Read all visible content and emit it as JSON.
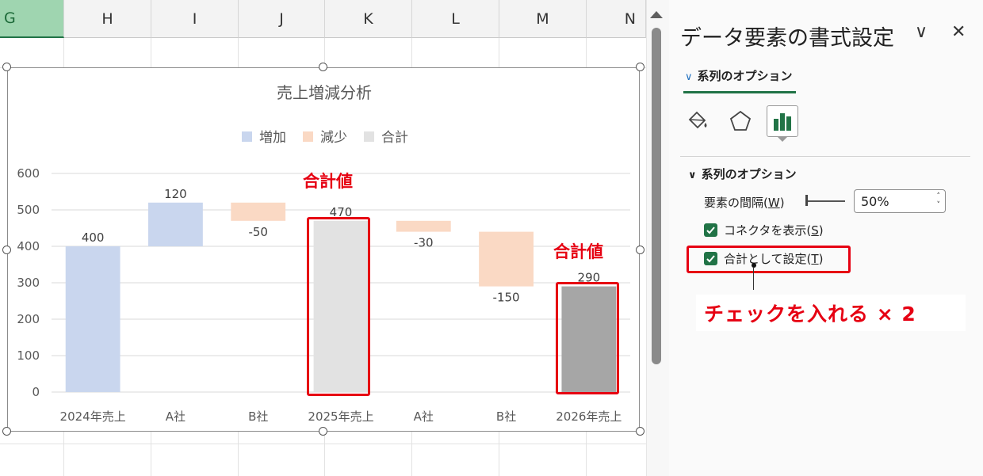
{
  "columns": [
    "G",
    "H",
    "I",
    "J",
    "K",
    "L",
    "M",
    "N"
  ],
  "panel": {
    "title": "データ要素の書式設定",
    "collapse_glyph": "∨",
    "close_glyph": "✕",
    "tab_label": "系列のオプション",
    "section_label": "系列のオプション",
    "gap_label_prefix": "要素の間隔(",
    "gap_label_key": "W",
    "gap_label_suffix": ")",
    "gap_value": "50%",
    "connector_prefix": "コネクタを表示(",
    "connector_key": "S",
    "connector_suffix": ")",
    "total_prefix": "合計として設定(",
    "total_key": "T",
    "total_suffix": ")",
    "icons": [
      "fill-line-icon",
      "effects-icon",
      "series-options-icon"
    ]
  },
  "annotations": {
    "total_label_1": "合計値",
    "total_label_2": "合計値",
    "callout": "チェックを入れる × 2"
  },
  "colors": {
    "increase": "#c9d6ee",
    "decrease": "#fad9c4",
    "total": "#e2e2e2",
    "total_selected": "#a6a6a6",
    "accent": "#217346",
    "annotation_red": "#e60012"
  },
  "chart_data": {
    "type": "bar",
    "subtype": "waterfall",
    "title": "売上増減分析",
    "legend": {
      "position": "top",
      "entries": [
        "増加",
        "減少",
        "合計"
      ]
    },
    "categories": [
      "2024年売上",
      "A社",
      "B社",
      "2025年売上",
      "A社",
      "B社",
      "2026年売上"
    ],
    "values": [
      400,
      120,
      -50,
      470,
      -30,
      -150,
      290
    ],
    "labels": [
      "400",
      "120",
      "-50",
      "470",
      "-30",
      "-150",
      "290"
    ],
    "kinds": [
      "increase",
      "increase",
      "decrease",
      "total",
      "decrease",
      "decrease",
      "total"
    ],
    "yticks": [
      "0",
      "100",
      "200",
      "300",
      "400",
      "500",
      "600"
    ],
    "ylim": [
      0,
      600
    ],
    "grid": true
  }
}
